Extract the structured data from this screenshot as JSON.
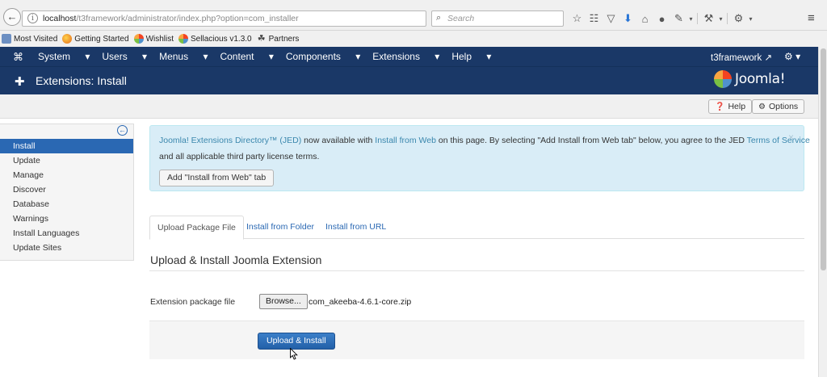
{
  "browser": {
    "url_host": "localhost",
    "url_path": "/t3framework/administrator/index.php?option=com_installer",
    "search_placeholder": "Search",
    "bookmarks": [
      "Most Visited",
      "Getting Started",
      "Wishlist",
      "Sellacious v1.3.0",
      "Partners"
    ]
  },
  "joomla_nav": {
    "menu": [
      "System",
      "Users",
      "Menus",
      "Content",
      "Components",
      "Extensions",
      "Help"
    ],
    "user_link": "t3framework"
  },
  "header": {
    "title": "Extensions: Install",
    "logo_text": "Joomla!"
  },
  "toolbar": {
    "help_label": "Help",
    "options_label": "Options"
  },
  "sidebar": {
    "items": [
      {
        "label": "Install",
        "active": true
      },
      {
        "label": "Update",
        "active": false
      },
      {
        "label": "Manage",
        "active": false
      },
      {
        "label": "Discover",
        "active": false
      },
      {
        "label": "Database",
        "active": false
      },
      {
        "label": "Warnings",
        "active": false
      },
      {
        "label": "Install Languages",
        "active": false
      },
      {
        "label": "Update Sites",
        "active": false
      }
    ]
  },
  "alert": {
    "jed_link": "Joomla! Extensions Directory™ (JED)",
    "text_1": " now available with ",
    "install_web_link": "Install from Web",
    "text_2": " on this page.  By selecting \"Add Install from Web tab\" below, you agree to the JED ",
    "tos_link": "Terms of Service",
    "text_3": "and all applicable third party license terms.",
    "button_label": "Add \"Install from Web\" tab",
    "close_symbol": "×"
  },
  "tabs": [
    {
      "label": "Upload Package File",
      "active": true
    },
    {
      "label": "Install from Folder",
      "active": false
    },
    {
      "label": "Install from URL",
      "active": false
    }
  ],
  "form": {
    "section_title": "Upload & Install Joomla Extension",
    "field_label": "Extension package file",
    "browse_label": "Browse...",
    "file_name": "com_akeeba-4.6.1-core.zip",
    "submit_label": "Upload & Install"
  },
  "colors": {
    "navbar": "#1a3867",
    "primary": "#2a68b3",
    "alert_bg": "#d9edf7",
    "link": "#3a87ad"
  }
}
